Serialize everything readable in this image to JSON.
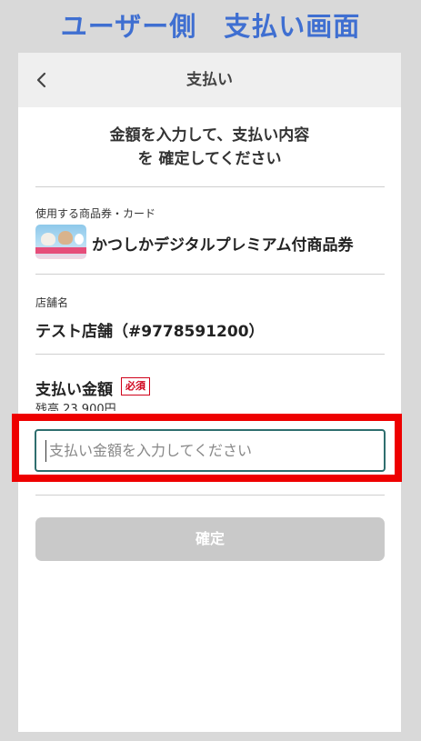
{
  "page_heading": "ユーザー側　支払い画面",
  "header": {
    "title": "支払い",
    "back_icon": "chevron-left-icon"
  },
  "instruction": {
    "line1": "金額を入力して、支払い内容",
    "line2": "を 確定してください"
  },
  "voucher": {
    "label": "使用する商品券・カード",
    "name": "かつしかデジタルプレミアム付商品券",
    "thumbnail": "voucher-cats-image"
  },
  "store": {
    "label": "店舗名",
    "name": "テスト店舗（#9778591200）"
  },
  "amount": {
    "label": "支払い金額",
    "required": "必須",
    "balance": "残高 23,900円",
    "placeholder": "支払い金額を入力してください",
    "value": ""
  },
  "confirm_button": {
    "label": "確定"
  },
  "colors": {
    "heading": "#3f6fd1",
    "highlight": "#ee0000",
    "required": "#d0021b",
    "input_border": "#2f6e6e",
    "button_disabled": "#c9c9c9"
  }
}
